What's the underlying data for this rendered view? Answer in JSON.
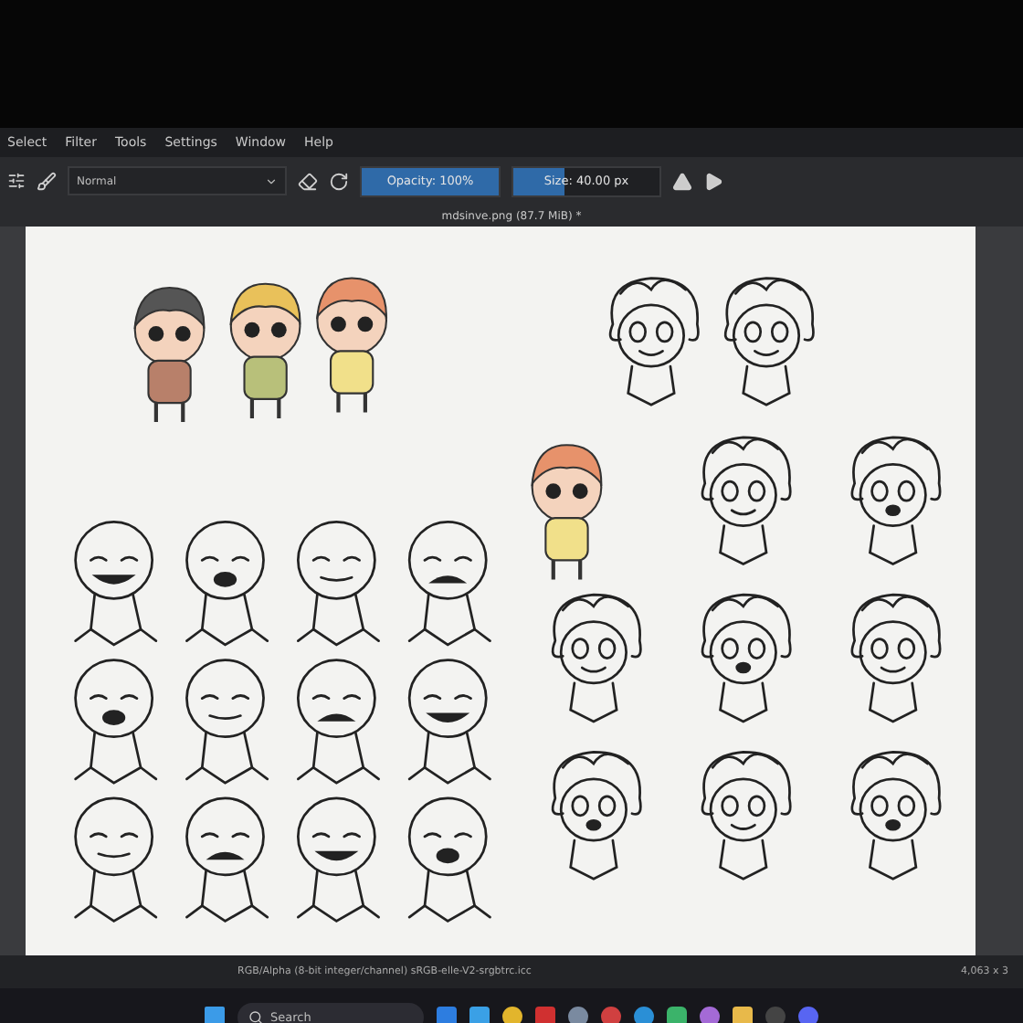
{
  "menu": [
    "Select",
    "Filter",
    "Tools",
    "Settings",
    "Window",
    "Help"
  ],
  "toolbar": {
    "blend_mode": "Normal",
    "opacity": {
      "text": "Opacity: 100%",
      "level": 1
    },
    "size": {
      "text": "Size: 40.00 px",
      "level": 0.35
    }
  },
  "document": {
    "title": "mdsinve.png (87.7 MiB) *"
  },
  "status_bar": {
    "color_space": "RGB/Alpha (8-bit integer/channel)  sRGB-elle-V2-srgbtrc.icc",
    "dimensions": "4,063 x 3"
  },
  "taskbar": {
    "search_placeholder": "Search"
  }
}
